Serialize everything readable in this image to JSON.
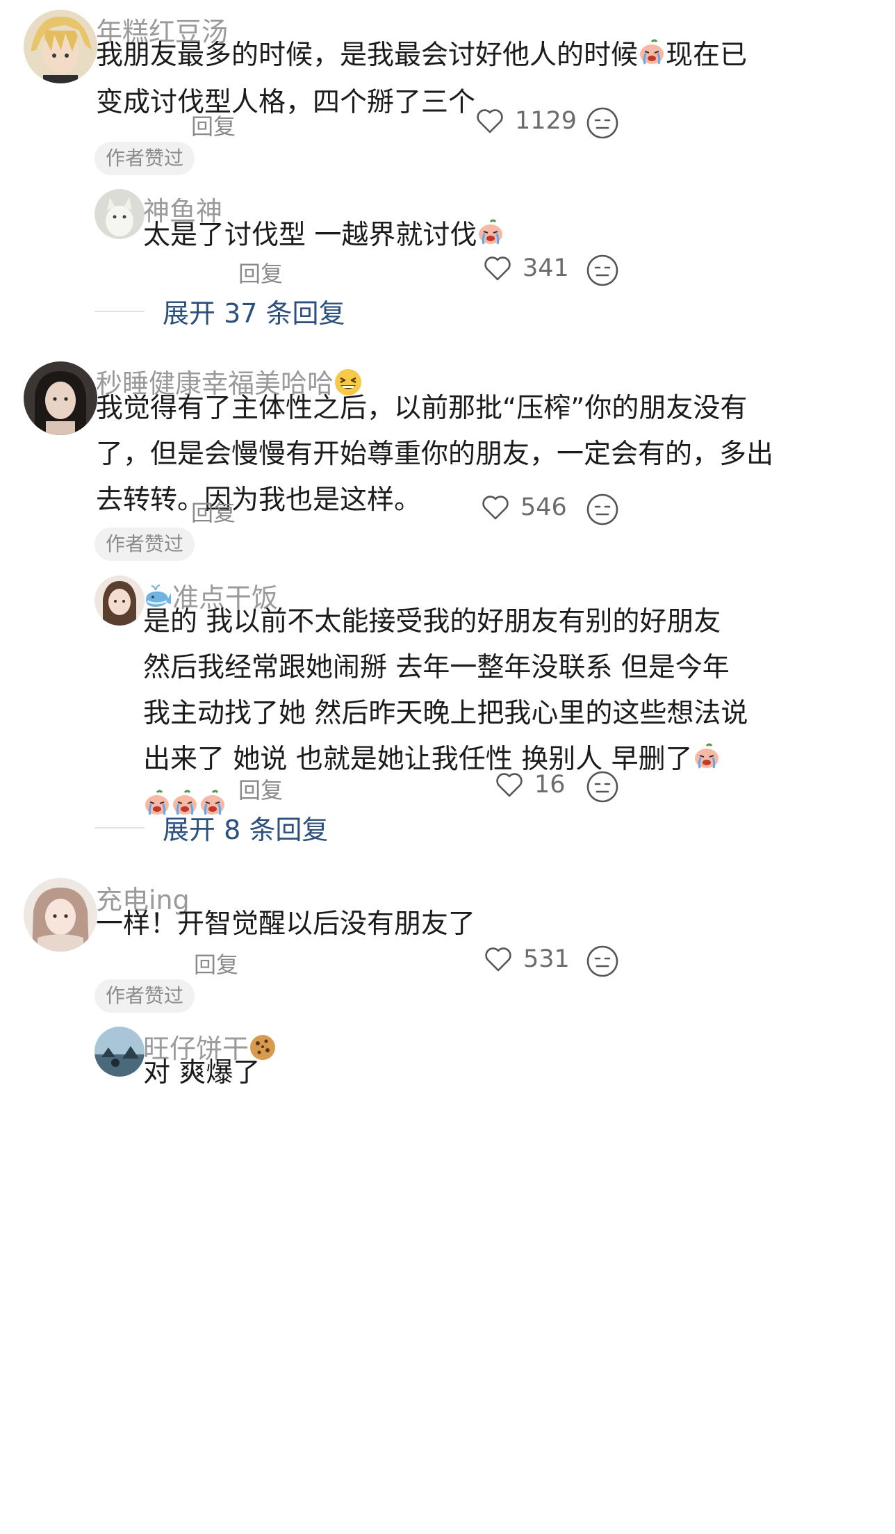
{
  "comments": [
    {
      "username": "年糕红豆汤",
      "lines": [
        "我朋友最多的时候，是我最会讨好他人的时候",
        "现在已",
        "变成讨伐型人格，四个掰了三个"
      ],
      "reply_label": "回复",
      "likes": "1129",
      "author_liked": "作者赞过",
      "replies": [
        {
          "username": "神鱼神",
          "text": "太是了讨伐型 一越界就讨伐",
          "reply_label": "回复",
          "likes": "341"
        }
      ],
      "expand_label": "展开 37 条回复"
    },
    {
      "username": "秒睡健康幸福美哈哈",
      "lines": [
        "我觉得有了主体性之后，以前那批“压榨”你的朋友没有",
        "了，但是会慢慢有开始尊重你的朋友，一定会有的，多出",
        "去转转。因为我也是这样。"
      ],
      "reply_label": "回复",
      "likes": "546",
      "author_liked": "作者赞过",
      "replies": [
        {
          "username": "准点干饭",
          "lines": [
            "是的  我以前不太能接受我的好朋友有别的好朋友",
            "然后我经常跟她闹掰  去年一整年没联系  但是今年",
            "我主动找了她   然后昨天晚上把我心里的这些想法说",
            "出来了  她说  也就是她让我任性 换别人  早删了"
          ],
          "reply_label": "回复",
          "likes": "16"
        }
      ],
      "expand_label": "展开 8 条回复"
    },
    {
      "username": "充电ing",
      "text": "一样！开智觉醒以后没有朋友了",
      "reply_label": "回复",
      "likes": "531",
      "author_liked": "作者赞过",
      "replies": [
        {
          "username": "旺仔饼干",
          "text": "对 爽爆了"
        }
      ]
    }
  ],
  "icons": {
    "like": "heart-outline-icon",
    "dislike": "neutral-face-icon",
    "crying_emoji": "crying-face-emoji",
    "grin_emoji": "grinning-squint-emoji",
    "cookie_emoji": "cookie-emoji",
    "whale_emoji": "whale-emoji"
  },
  "colors": {
    "username": "#9a9a9a",
    "text": "#1b1b1b",
    "expand_link": "#2c4f7c",
    "badge_bg": "#f1f1f1"
  }
}
